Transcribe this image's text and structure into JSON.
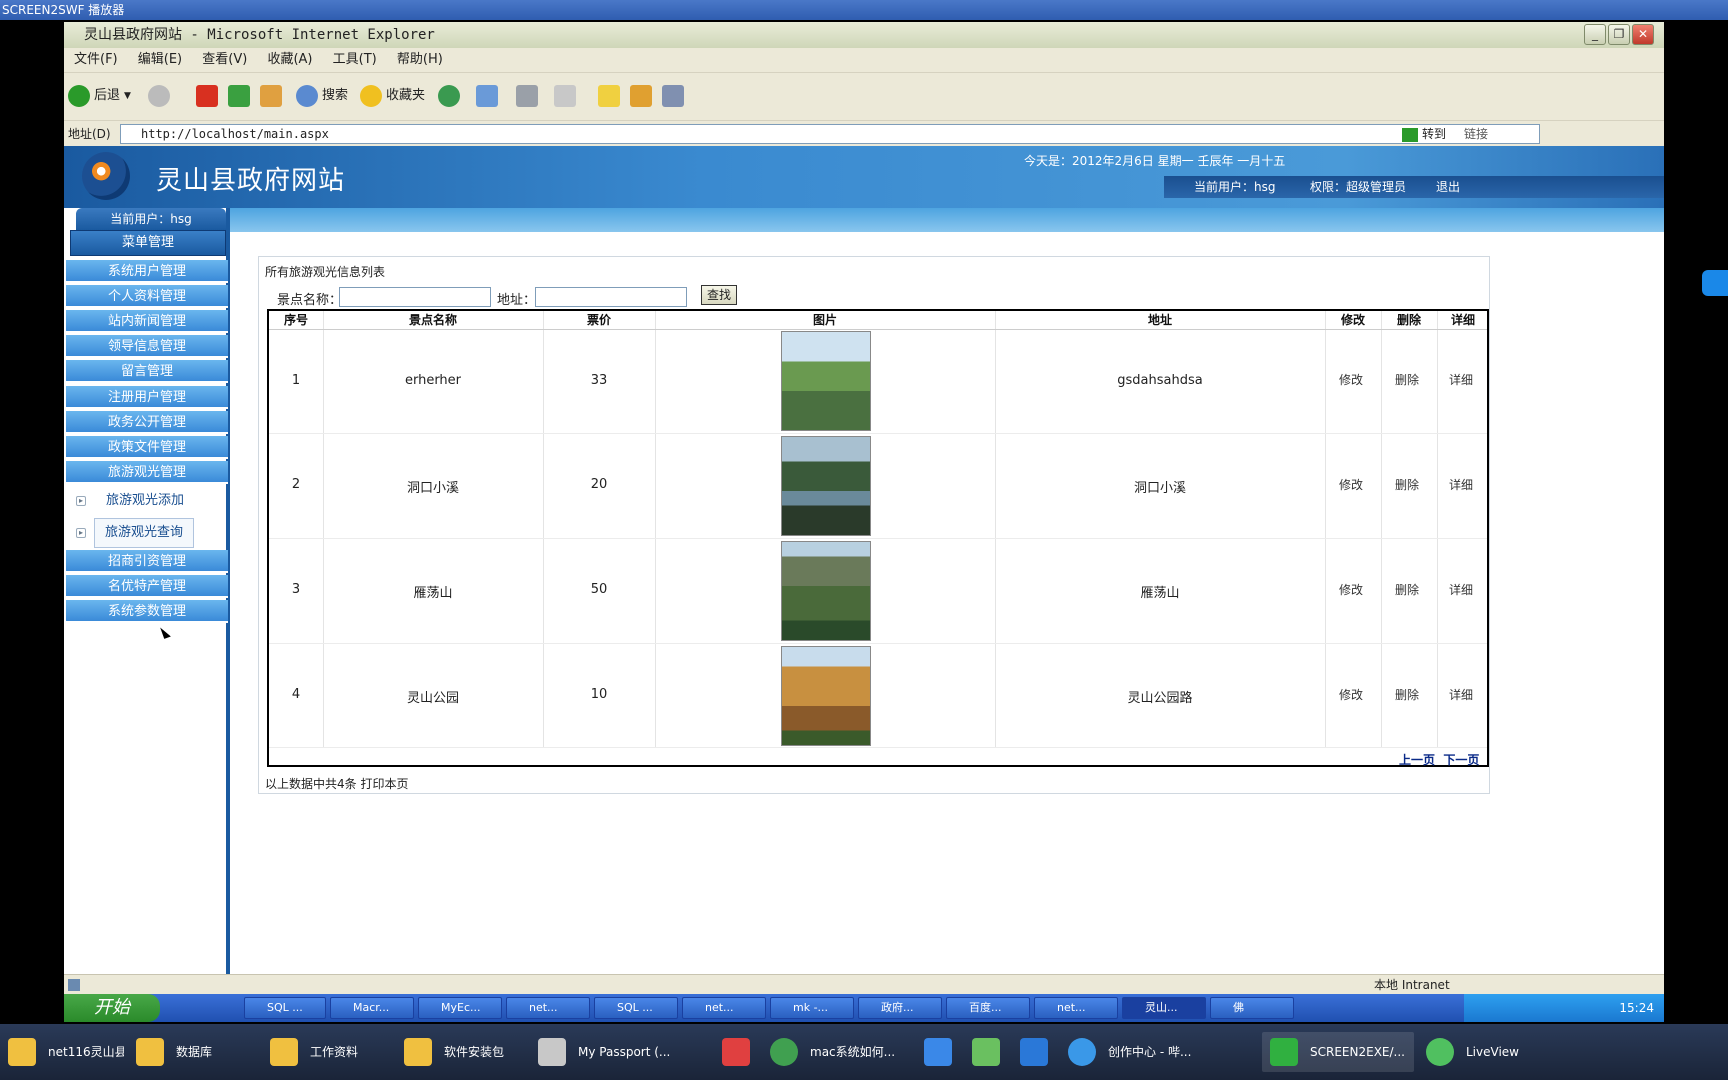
{
  "player": {
    "title": "SCREEN2SWF 播放器"
  },
  "window": {
    "title": "灵山县政府网站 - Microsoft Internet Explorer"
  },
  "menubar": [
    "文件(F)",
    "编辑(E)",
    "查看(V)",
    "收藏(A)",
    "工具(T)",
    "帮助(H)"
  ],
  "toolbar": {
    "back": "后退",
    "search": "搜索",
    "favorites": "收藏夹"
  },
  "addressbar": {
    "label": "地址(D)",
    "url": "http://localhost/main.aspx",
    "go": "转到",
    "links": "链接"
  },
  "site": {
    "title": "灵山县政府网站",
    "date": "今天是：2012年2月6日 星期一 壬辰年 一月十五",
    "current_user": "当前用户：hsg",
    "role": "权限：超级管理员",
    "logout": "退出"
  },
  "sidebar": {
    "user_tab": "当前用户：hsg",
    "menu_head": "菜单管理",
    "items": [
      "系统用户管理",
      "个人资料管理",
      "站内新闻管理",
      "领导信息管理",
      "留言管理",
      "注册用户管理",
      "政务公开管理",
      "政策文件管理",
      "旅游观光管理"
    ],
    "sub_items": [
      "旅游观光添加",
      "旅游观光查询"
    ],
    "items_after": [
      "招商引资管理",
      "名优特产管理",
      "系统参数管理"
    ]
  },
  "panel": {
    "title": "所有旅游观光信息列表",
    "search_name_label": "景点名称：",
    "search_addr_label": "地址：",
    "search_button": "查找",
    "footer": "以上数据中共4条  打印本页",
    "prev": "上一页",
    "next": "下一页"
  },
  "table": {
    "headers": [
      "序号",
      "景点名称",
      "票价",
      "图片",
      "地址",
      "修改",
      "删除",
      "详细"
    ],
    "rows": [
      {
        "id": "1",
        "name": "erherher",
        "price": "33",
        "address": "gsdahsahdsa",
        "edit": "修改",
        "del": "删除",
        "detail": "详细"
      },
      {
        "id": "2",
        "name": "洞口小溪",
        "price": "20",
        "address": "洞口小溪",
        "edit": "修改",
        "del": "删除",
        "detail": "详细"
      },
      {
        "id": "3",
        "name": "雁荡山",
        "price": "50",
        "address": "雁荡山",
        "edit": "修改",
        "del": "删除",
        "detail": "详细"
      },
      {
        "id": "4",
        "name": "灵山公园",
        "price": "10",
        "address": "灵山公园路",
        "edit": "修改",
        "del": "删除",
        "detail": "详细"
      }
    ]
  },
  "statusbar": {
    "zone": "本地 Intranet"
  },
  "xp_taskbar": {
    "start": "开始",
    "tasks": [
      "SQL ...",
      "Macr...",
      "MyEc...",
      "net...",
      "SQL ...",
      "net...",
      "mk -...",
      "政府...",
      "百度...",
      "net...",
      "灵山...",
      "佛"
    ],
    "clock": "15:24"
  },
  "host_taskbar": {
    "tasks": [
      "net116灵山县...",
      "数据库",
      "工作资料",
      "软件安装包",
      "My Passport (...",
      "mac系统如何...",
      "创作中心 - 哔...",
      "SCREEN2EXE/...",
      "LiveView"
    ]
  },
  "colors": {
    "header": "#1a5aa0",
    "menu": "#3a8ad8",
    "link": "#0a2a88"
  }
}
